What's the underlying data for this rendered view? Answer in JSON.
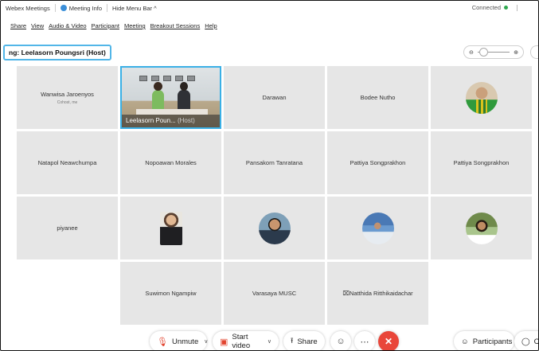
{
  "titlebar": {
    "app": "Webex Meetings",
    "info": "Meeting Info",
    "hide": "Hide Menu Bar ^",
    "status": "Connected"
  },
  "menu": [
    "Share",
    "View",
    "Audio & Video",
    "Participant",
    "Meeting",
    "Breakout Sessions",
    "Help"
  ],
  "speaker": "ng: Leelasorn Poungsri (Host)",
  "zoom": {
    "minus": "⊖",
    "plus": "⊕"
  },
  "participants": [
    {
      "name": "Wanwisa Jaroenyos",
      "sub": "Cohost, me"
    },
    {
      "name": "Leelasorn Poun...",
      "host": "(Host)"
    },
    {
      "name": "Darawan"
    },
    {
      "name": "Bodee Nutho"
    },
    {
      "name": "",
      "avatar": "av1"
    },
    {
      "name": "Natapol Neawchumpa"
    },
    {
      "name": "Nopoawan Morales"
    },
    {
      "name": "Pansakorn Tanratana"
    },
    {
      "name": "Pattiya Songprakhon"
    },
    {
      "name": "Pattiya Songprakhon"
    },
    {
      "name": "piyanee"
    },
    {
      "name": "",
      "avatar": "av2"
    },
    {
      "name": "",
      "avatar": "av3"
    },
    {
      "name": "",
      "avatar": "av4"
    },
    {
      "name": "",
      "avatar": "av5"
    },
    {
      "name": "Suwimon Ngampiw"
    },
    {
      "name": "Varasaya MUSC"
    },
    {
      "name": "⌧Natthida Ritthikaidachar"
    }
  ],
  "controls": {
    "unmute": "Unmute",
    "start_video": "Start video",
    "share": "Share",
    "participants": "Participants",
    "chat": "Ch"
  },
  "colors": {
    "accent": "#3ab0e6",
    "leave": "#e9463a",
    "mute_icon": "#e2432e"
  }
}
